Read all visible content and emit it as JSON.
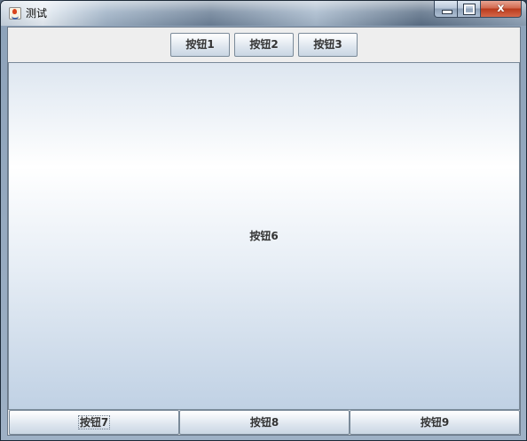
{
  "window": {
    "title": "测试",
    "controls": {
      "minimize_icon": "minimize-icon",
      "maximize_icon": "maximize-icon",
      "close_symbol": "x"
    },
    "app_icon": "java-cup-icon"
  },
  "north": {
    "buttons": [
      {
        "label": "按钮1"
      },
      {
        "label": "按钮2"
      },
      {
        "label": "按钮3"
      }
    ]
  },
  "center": {
    "button": {
      "label": "按钮6"
    }
  },
  "south": {
    "buttons": [
      {
        "label": "按钮7",
        "focused": true
      },
      {
        "label": "按钮8"
      },
      {
        "label": "按钮9"
      }
    ]
  },
  "colors": {
    "close_button": "#c8462a",
    "button_text": "#333333",
    "panel_bg": "#eeeeee"
  }
}
